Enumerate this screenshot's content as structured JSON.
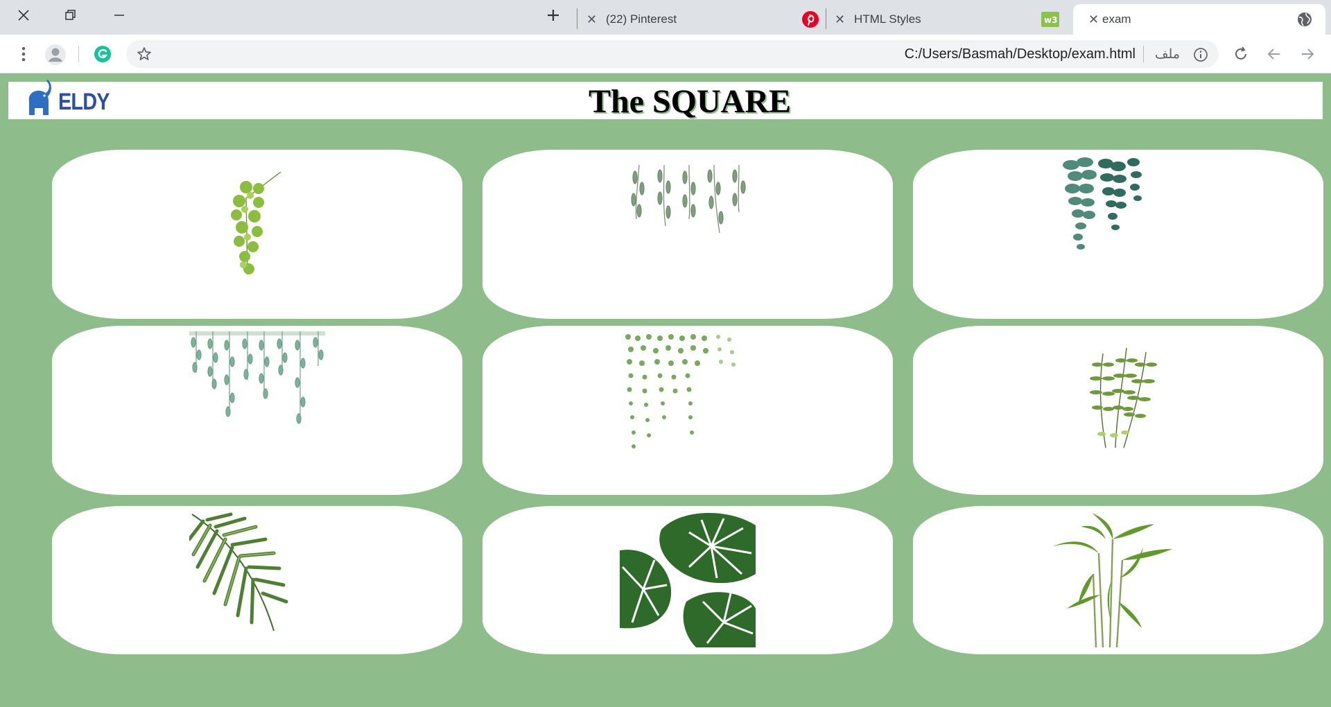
{
  "window": {
    "close_label": "✕",
    "restore_label": "⧉",
    "minimize_label": "—"
  },
  "tabs": [
    {
      "label": "(22) Pinterest",
      "icon": "pinterest-icon"
    },
    {
      "label": "HTML Styles",
      "icon": "w3schools-icon"
    },
    {
      "label": "exam",
      "icon": "globe-icon",
      "active": true
    }
  ],
  "new_tab_label": "+",
  "address_bar": {
    "url": "C:/Users/Basmah/Desktop/exam.html",
    "badge": "ملف"
  },
  "page": {
    "logo_text": "ELDY",
    "title": "The SQUARE"
  },
  "cards": [
    {
      "name": "maidenhair-fern"
    },
    {
      "name": "hanging-willow"
    },
    {
      "name": "eucalyptus"
    },
    {
      "name": "weeping-vines"
    },
    {
      "name": "string-of-pearls"
    },
    {
      "name": "fern-fronds"
    },
    {
      "name": "palm-leaf"
    },
    {
      "name": "monstera-leaves"
    },
    {
      "name": "bamboo"
    }
  ],
  "colors": {
    "page_bg": "#8fbc8b",
    "card_bg": "#ffffff",
    "chrome_bg": "#dee1e6"
  }
}
